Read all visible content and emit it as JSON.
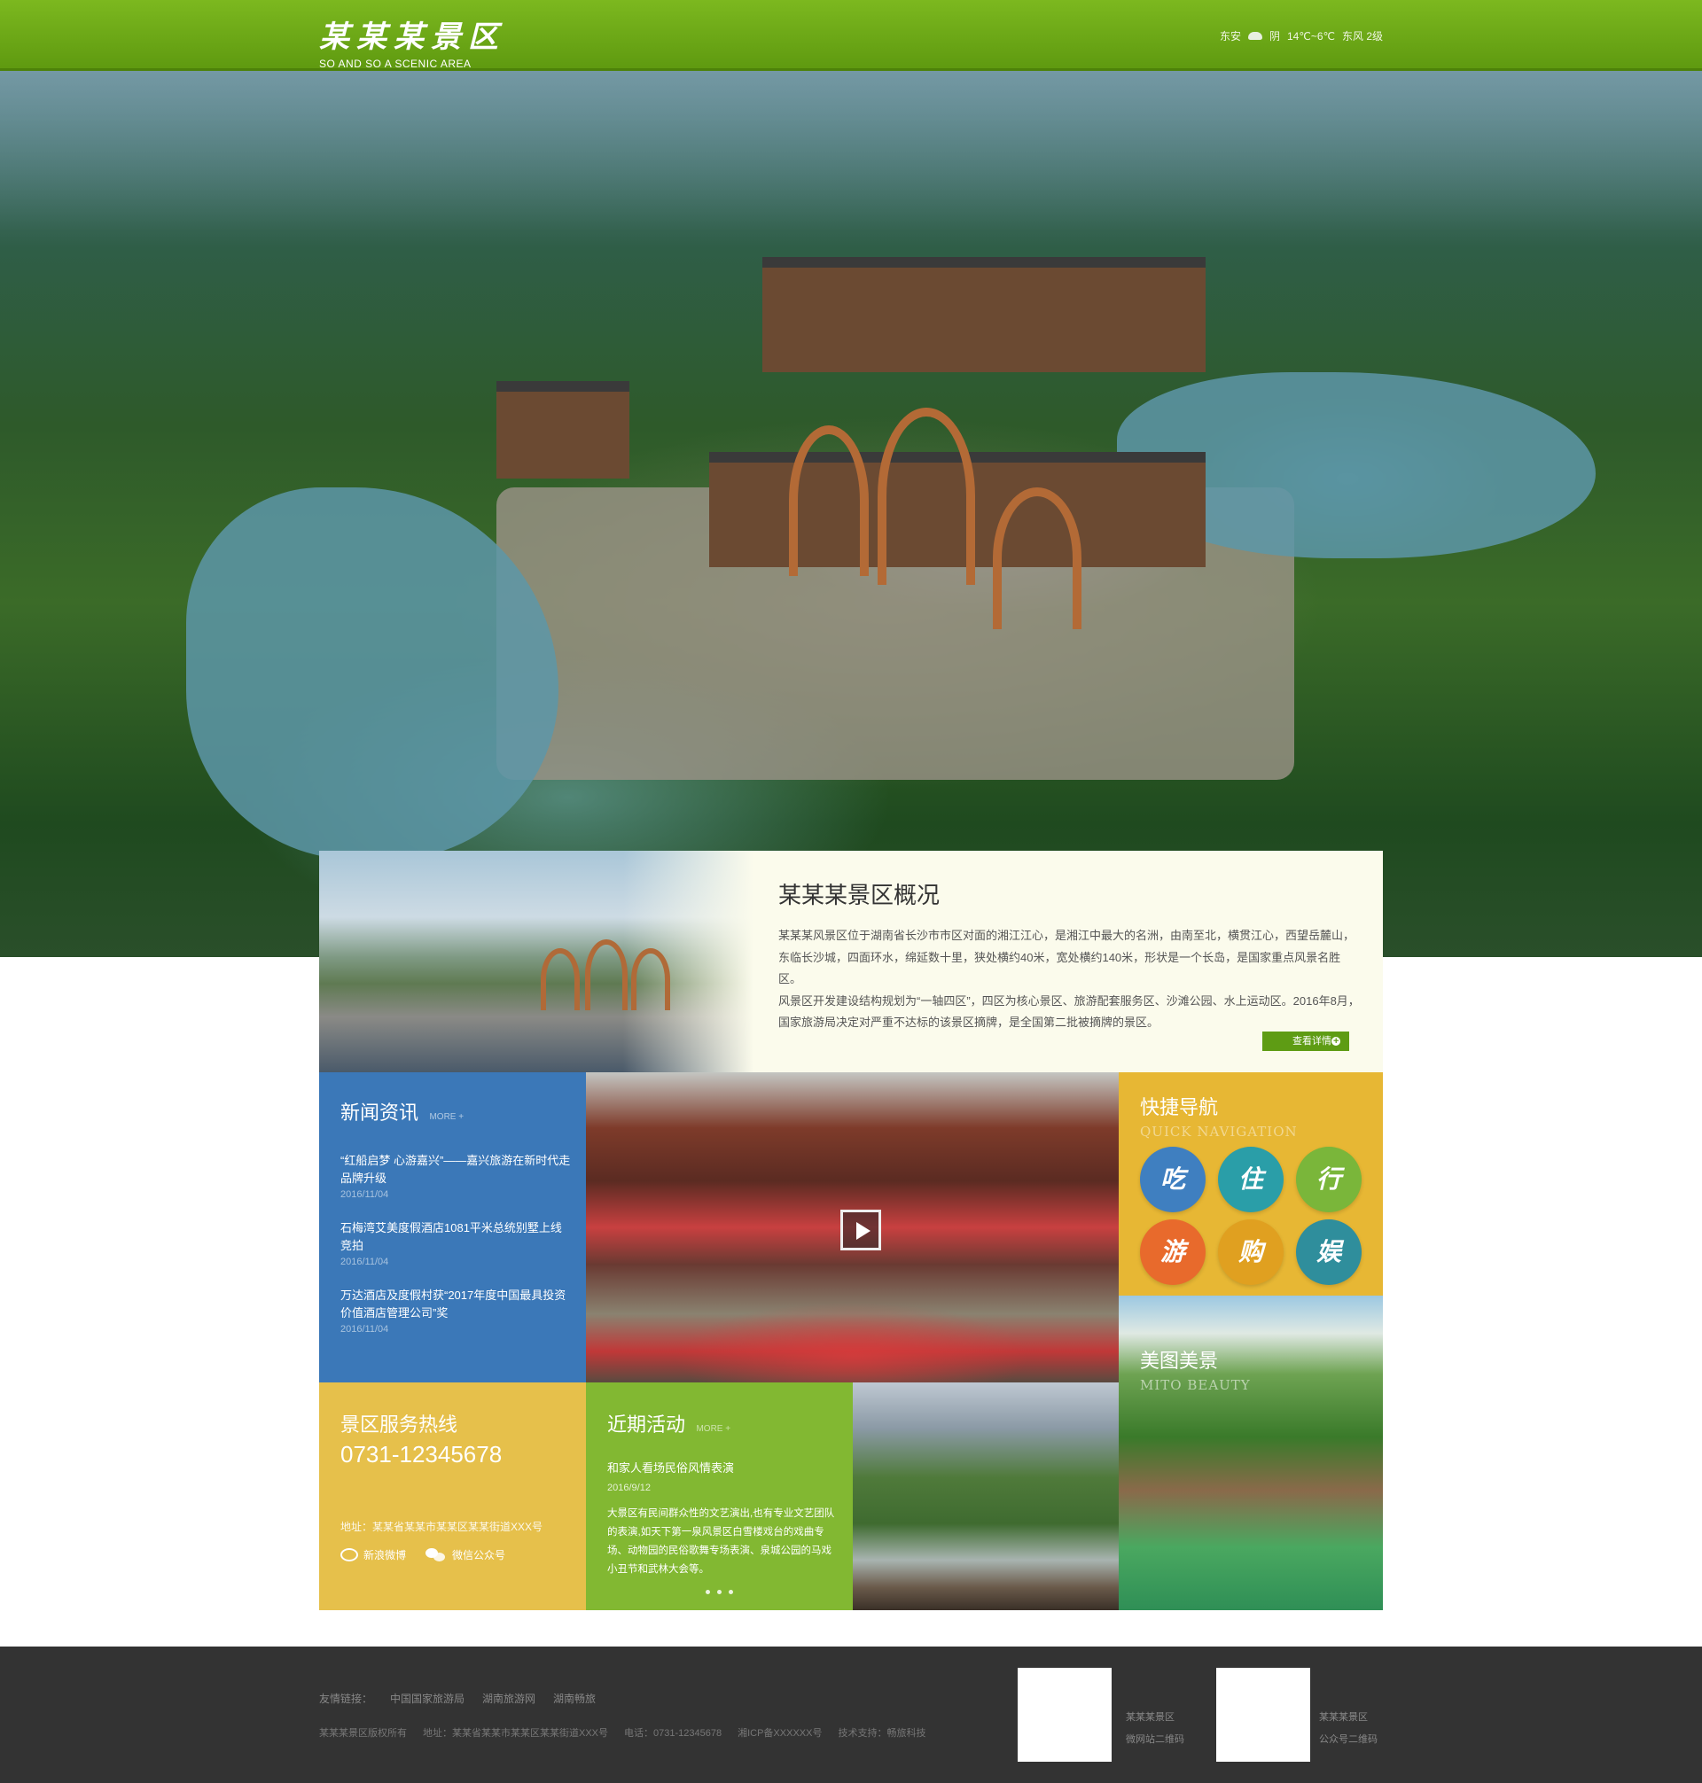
{
  "header": {
    "logo_cn": "某某某景区",
    "logo_en": "SO AND SO A SCENIC AREA",
    "weather": {
      "city": "东安",
      "condition": "阴",
      "temp": "14℃~6℃",
      "wind": "东风 2级"
    }
  },
  "overview": {
    "title": "某某某景区概况",
    "paragraph1": "某某某风景区位于湖南省长沙市市区对面的湘江江心，是湘江中最大的名洲，由南至北，横贯江心，西望岳麓山，东临长沙城，四面环水，绵延数十里，狭处横约40米，宽处横约140米，形状是一个长岛，是国家重点风景名胜区。",
    "paragraph2": "风景区开发建设结构规划为“一轴四区”，四区为核心景区、旅游配套服务区、沙滩公园、水上运动区。2016年8月，国家旅游局决定对严重不达标的该景区摘牌，是全国第二批被摘牌的景区。",
    "detail_button": "查看详情"
  },
  "news": {
    "title": "新闻资讯",
    "more": "MORE +",
    "items": [
      {
        "title": "“红船启梦 心游嘉兴”——嘉兴旅游在新时代走品牌升级",
        "date": "2016/11/04"
      },
      {
        "title": "石梅湾艾美度假酒店1081平米总统别墅上线竞拍",
        "date": "2016/11/04"
      },
      {
        "title": "万达酒店及度假村获“2017年度中国最具投资价值酒店管理公司”奖",
        "date": "2016/11/04"
      }
    ]
  },
  "quick_nav": {
    "title": "快捷导航",
    "subtitle": "QUICK NAVIGATION",
    "items": [
      {
        "label": "吃",
        "color": "#3f7fc0"
      },
      {
        "label": "住",
        "color": "#2a9ea8"
      },
      {
        "label": "行",
        "color": "#7ab63a"
      },
      {
        "label": "游",
        "color": "#e86a2c"
      },
      {
        "label": "购",
        "color": "#e0a020"
      },
      {
        "label": "娱",
        "color": "#2f8e9c"
      }
    ]
  },
  "beauty": {
    "title": "美图美景",
    "subtitle": "MITO BEAUTY"
  },
  "hotline": {
    "title": "景区服务热线",
    "phone": "0731-12345678",
    "address": "地址：某某省某某市某某区某某街道XXX号",
    "weibo": "新浪微博",
    "wechat": "微信公众号"
  },
  "activity": {
    "title": "近期活动",
    "more": "MORE +",
    "item_title": "和家人看场民俗风情表演",
    "item_date": "2016/9/12",
    "item_desc": "大景区有民间群众性的文艺演出,也有专业文艺团队的表演,如天下第一泉风景区白雪楼戏台的戏曲专场、动物园的民俗歌舞专场表演、泉城公园的马戏小丑节和武林大会等。"
  },
  "footer": {
    "links_label": "友情链接：",
    "links": [
      "中国国家旅游局",
      "湖南旅游网",
      "湖南畅旅"
    ],
    "copyright": "某某某景区版权所有",
    "address": "地址：某某省某某市某某区某某街道XXX号",
    "phone": "电话：0731-12345678",
    "icp": "湘ICP备XXXXXX号",
    "support": "技术支持：畅旅科技",
    "qr1_name": "某某某景区",
    "qr1_label": "微网站二维码",
    "qr2_name": "某某某景区",
    "qr2_label": "公众号二维码"
  },
  "colors": {
    "header_green": "#6fa817",
    "news_blue": "#3b78b8",
    "quicknav_yellow": "#e7b734",
    "hotline_yellow": "#e6c04b",
    "activity_green": "#82b832",
    "footer_dark": "#333333"
  }
}
